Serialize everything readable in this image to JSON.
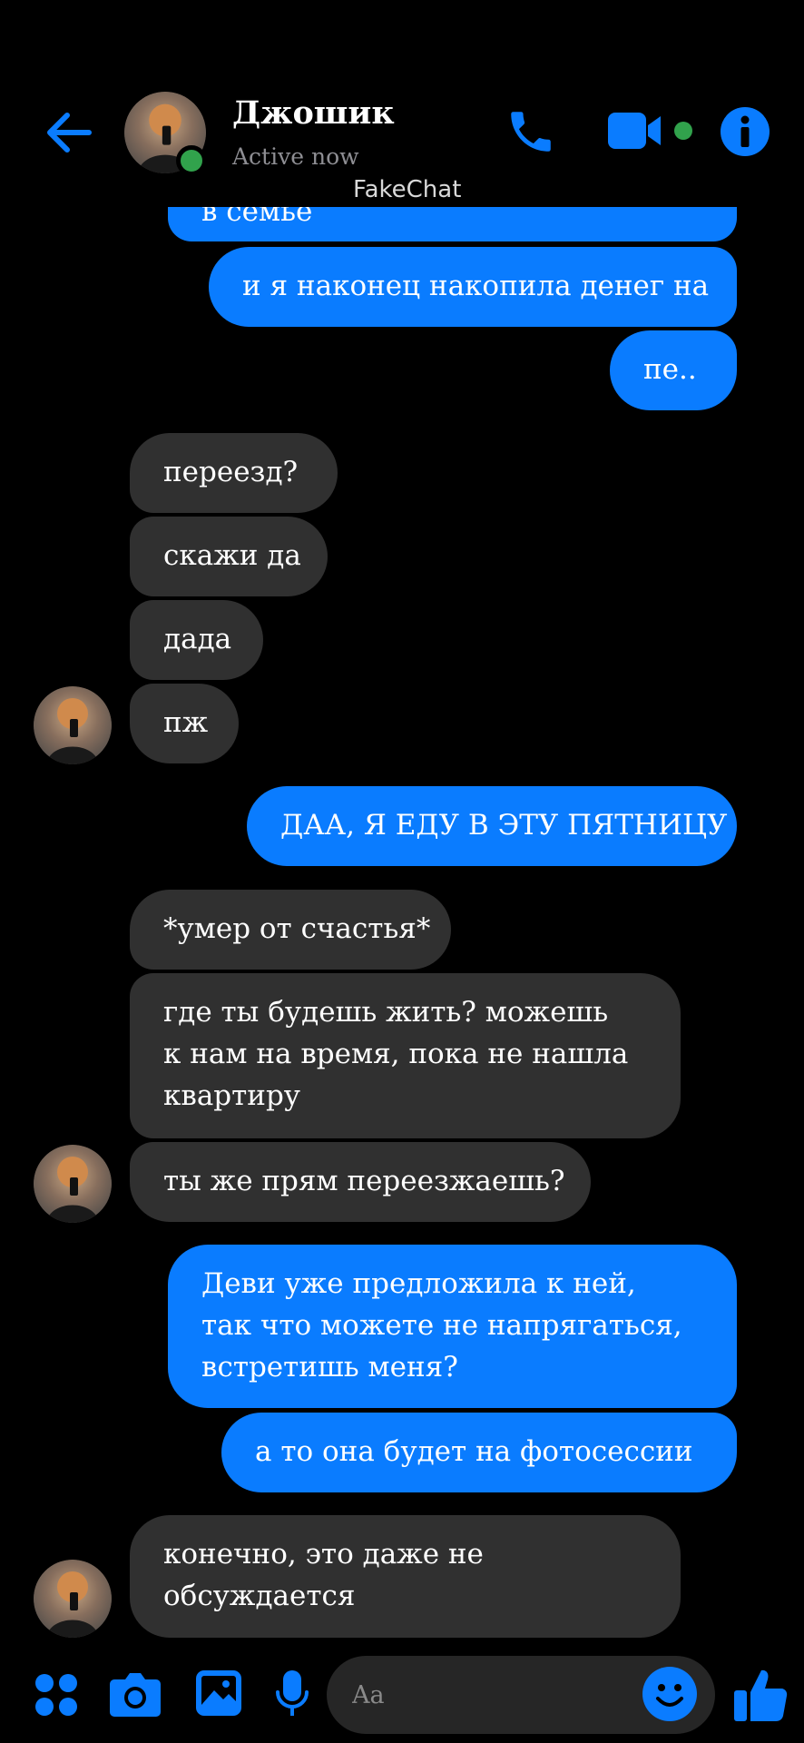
{
  "header": {
    "contact_name": "Джошик",
    "status": "Active now",
    "watermark": "FakeChat",
    "back_icon": "arrow-left-icon",
    "call_icon": "phone-icon",
    "video_icon": "video-camera-icon",
    "info_icon": "info-icon"
  },
  "colors": {
    "accent": "#0a7cff",
    "incoming_bubble": "#303030",
    "online": "#31a24c",
    "background": "#000000"
  },
  "messages": [
    {
      "side": "out",
      "text": "в семье"
    },
    {
      "side": "out",
      "text": "и я наконец накопила денег на"
    },
    {
      "side": "out",
      "text": "пе.."
    },
    {
      "side": "in",
      "text": "переезд?"
    },
    {
      "side": "in",
      "text": "скажи да"
    },
    {
      "side": "in",
      "text": "дада"
    },
    {
      "side": "in",
      "text": "пж"
    },
    {
      "side": "out",
      "text": "ДАА, Я ЕДУ В ЭТУ ПЯТНИЦУ"
    },
    {
      "side": "in",
      "text": "*умер от счастья*"
    },
    {
      "side": "in",
      "lines": [
        "где ты будешь жить? можешь",
        "к нам на время, пока не нашла",
        "квартиру"
      ]
    },
    {
      "side": "in",
      "text": "ты же прям переезжаешь?"
    },
    {
      "side": "out",
      "lines": [
        "Деви уже предложила к ней,",
        "так что можете не напрягаться,",
        "встретишь меня?"
      ]
    },
    {
      "side": "out",
      "text": "а то она будет на фотосессии"
    },
    {
      "side": "in",
      "lines": [
        "конечно, это даже не",
        "обсуждается"
      ]
    }
  ],
  "composer": {
    "placeholder": "Aa",
    "icons": [
      "grid-icon",
      "camera-icon",
      "image-icon",
      "microphone-icon",
      "emoji-icon",
      "thumbs-up-icon"
    ]
  }
}
